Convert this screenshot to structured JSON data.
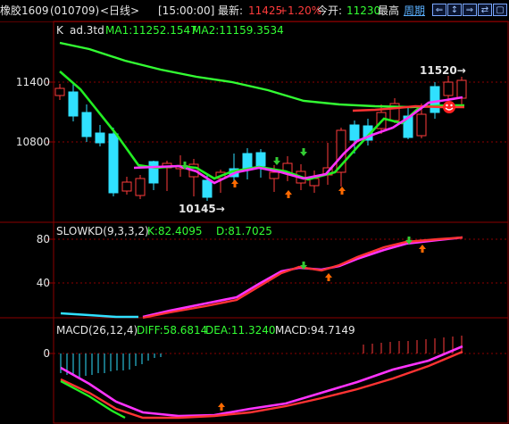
{
  "header": {
    "symbol": "橡胶1609",
    "code": "(010709)",
    "period": "<日线>",
    "time": "[15:00:00]",
    "latest_label": "最新:",
    "latest_value": "11425",
    "change_pct": "+1.20%",
    "open_label": "今开:",
    "open_value": "11230",
    "high_label": "最高",
    "weekly_link": "周期",
    "buttons": [
      "⇐",
      "↕",
      "⇒",
      "⇄",
      "▢"
    ]
  },
  "main_panel": {
    "indicator_name": "K",
    "period_name": "ad.3td",
    "ma1_label": "MA1:11252.1547",
    "ma2_label": "MA2:11159.3534",
    "y_ticks": [
      "11400",
      "10800"
    ],
    "high_annotation": "11520→",
    "low_annotation": "10145→",
    "colors": {
      "up": "#ff3b3b",
      "down": "#30e0ff",
      "ma1": "#33ff33",
      "ma2": "#ff3333",
      "ma_fast": "#ff33ff"
    }
  },
  "kd_panel": {
    "title": "SLOWKD(9,3,3,2)",
    "k_label": "K:82.4095",
    "d_label": "D:81.7025",
    "y_ticks": [
      "80",
      "40"
    ],
    "colors": {
      "k": "#ff3333",
      "d": "#ff33ff",
      "base": "#30e0ff"
    }
  },
  "macd_panel": {
    "title": "MACD(26,12,4)",
    "diff_label": "DIFF:58.6814",
    "dea_label": "DEA:11.3240",
    "macd_label": "MACD:94.7149",
    "y_ticks": [
      "0"
    ],
    "colors": {
      "diff": "#ff33ff",
      "dea": "#ff3333",
      "hist_pos": "#ff3b3b",
      "hist_neg": "#30e0ff"
    }
  }
}
